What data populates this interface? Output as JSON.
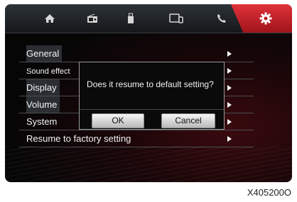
{
  "tabs": {
    "home": "home-icon",
    "radio": "radio-icon",
    "media": "usb-icon",
    "connect": "device-connect-icon",
    "phone": "phone-icon",
    "settings": "gear-icon"
  },
  "menu": {
    "items": [
      {
        "label": "General"
      },
      {
        "label": "Sound effect"
      },
      {
        "label": "Display"
      },
      {
        "label": "Volume"
      },
      {
        "label": "System"
      },
      {
        "label": "Resume to factory setting"
      }
    ]
  },
  "dialog": {
    "message": "Does it resume to default setting?",
    "ok_label": "OK",
    "cancel_label": "Cancel"
  },
  "footer": {
    "code": "X405200O"
  },
  "colors": {
    "accent": "#d0242c",
    "background": "#0b0b0c"
  }
}
